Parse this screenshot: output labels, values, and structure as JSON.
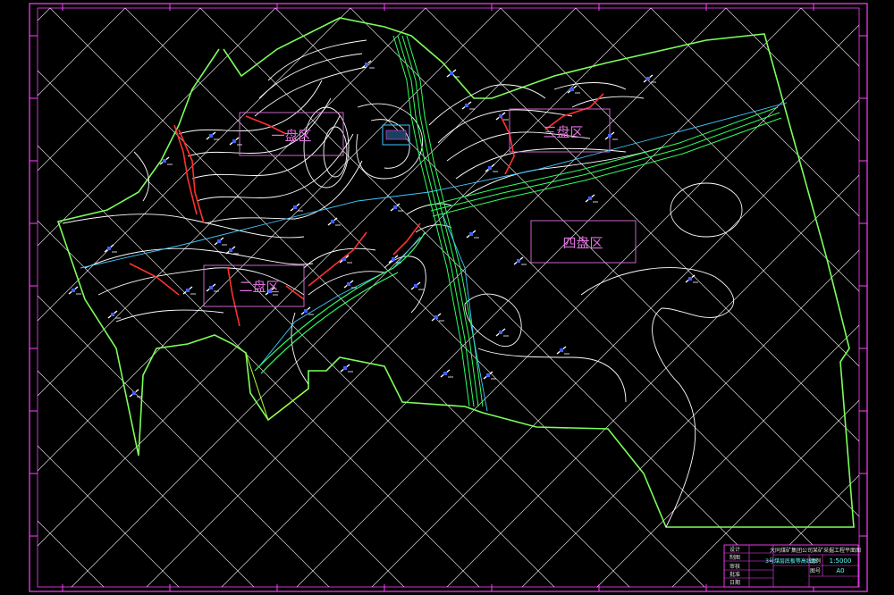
{
  "drawing": {
    "colors": {
      "frame": "#ff40ff",
      "grid": "#ffffff",
      "boundary": "#7dff5a",
      "contour": "#ffffff",
      "fault": "#ff3030",
      "roadway_green": "#30ff60",
      "roadway_cyan": "#40c8ff",
      "zone_box": "#e070e0"
    },
    "zones": [
      {
        "id": "zone-1",
        "label": "一盘区"
      },
      {
        "id": "zone-2",
        "label": "二盘区"
      },
      {
        "id": "zone-3",
        "label": "三盘区"
      },
      {
        "id": "zone-4",
        "label": "四盘区"
      }
    ],
    "marker_icon": "borehole-symbol-icon",
    "title_block": {
      "project_title": "大同煤矿集团公司某矿采掘工程平面图",
      "drawing_name": "3号煤层底板等高线图",
      "scale_label": "比例",
      "scale_value": "1:5000",
      "sheet_label": "图号",
      "sheet_value": "A0",
      "row_labels": [
        "设计",
        "制图",
        "审核",
        "批准",
        "日期"
      ]
    }
  }
}
